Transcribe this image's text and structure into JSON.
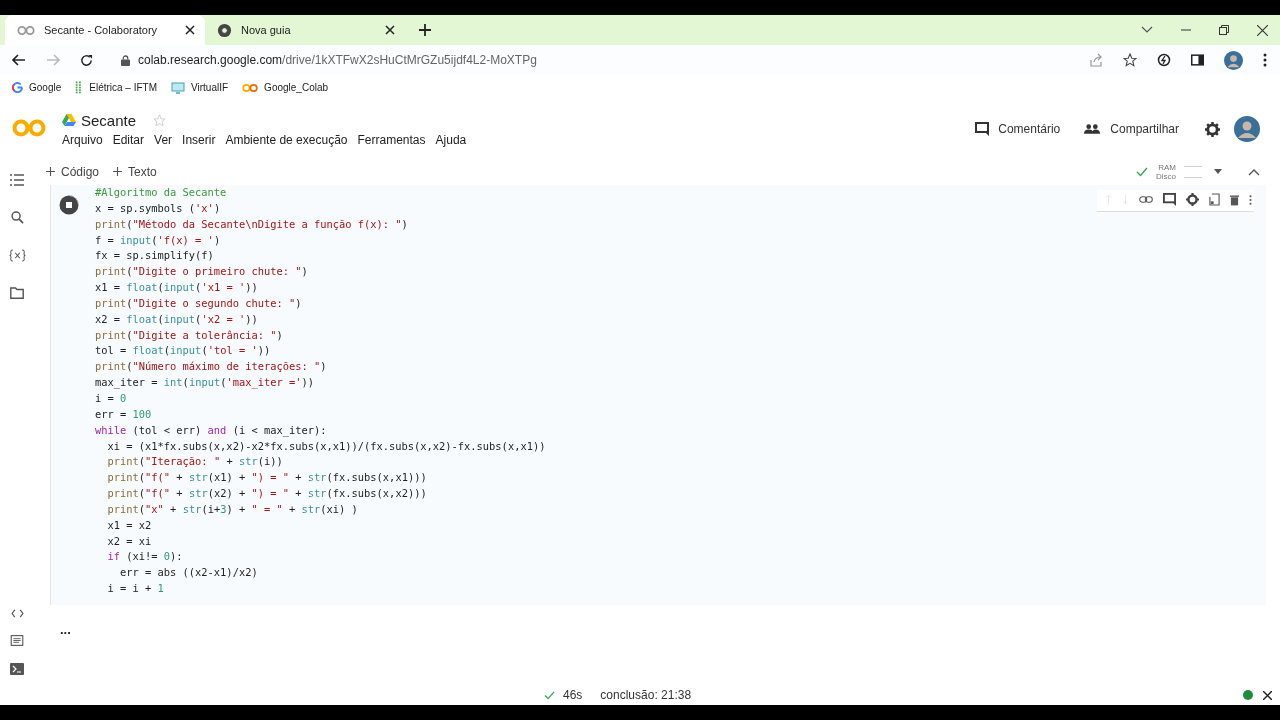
{
  "browser": {
    "tabs": [
      {
        "title": "Secante - Colaboratory",
        "selected": true,
        "kind": "colab"
      },
      {
        "title": "Nova guia",
        "selected": false,
        "kind": "chrome"
      }
    ],
    "forward_disabled": true,
    "address": {
      "host": "colab.research.google.com",
      "path": "/drive/1kXTFwX2sHuCtMrGZu5ijdf4L2-MoXTPg"
    },
    "bookmarks": [
      {
        "label": "Google",
        "kind": "google"
      },
      {
        "label": "Elétrica – IFTM",
        "kind": "grid"
      },
      {
        "label": "VirtualIF",
        "kind": "screen"
      },
      {
        "label": "Google_Colab",
        "kind": "colab"
      }
    ]
  },
  "notebook": {
    "title": "Secante",
    "starred": false,
    "menu": [
      "Arquivo",
      "Editar",
      "Ver",
      "Inserir",
      "Ambiente de execução",
      "Ferramentas",
      "Ajuda"
    ],
    "comment_button": "Comentário",
    "share_button": "Compartilhar",
    "add_buttons": [
      "Código",
      "Texto"
    ],
    "runtime": {
      "connected": true,
      "ram_label": "RAM",
      "disk_label": "Disco"
    },
    "cell": {
      "running": true,
      "lines": [
        [
          {
            "kind": "comment",
            "text": "#Algoritmo da Secante"
          }
        ],
        [
          {
            "kind": "plain",
            "text": "x = sp.symbols ("
          },
          {
            "kind": "string",
            "text": "'x'"
          },
          {
            "kind": "plain",
            "text": ")"
          }
        ],
        [
          {
            "kind": "function",
            "text": "print"
          },
          {
            "kind": "plain",
            "text": "("
          },
          {
            "kind": "string",
            "text": "\"Método da Secante\\nDigite a função f(x): \""
          },
          {
            "kind": "plain",
            "text": ")"
          }
        ],
        [
          {
            "kind": "plain",
            "text": "f = "
          },
          {
            "kind": "builtin",
            "text": "input"
          },
          {
            "kind": "plain",
            "text": "("
          },
          {
            "kind": "string",
            "text": "'f(x) = '"
          },
          {
            "kind": "plain",
            "text": ")"
          }
        ],
        [
          {
            "kind": "plain",
            "text": "fx = sp.simplify(f)"
          }
        ],
        [
          {
            "kind": "function",
            "text": "print"
          },
          {
            "kind": "plain",
            "text": "("
          },
          {
            "kind": "string",
            "text": "\"Digite o primeiro chute: \""
          },
          {
            "kind": "plain",
            "text": ")"
          }
        ],
        [
          {
            "kind": "plain",
            "text": "x1 = "
          },
          {
            "kind": "builtin",
            "text": "float"
          },
          {
            "kind": "plain",
            "text": "("
          },
          {
            "kind": "builtin",
            "text": "input"
          },
          {
            "kind": "plain",
            "text": "("
          },
          {
            "kind": "string",
            "text": "'x1 = '"
          },
          {
            "kind": "plain",
            "text": "))"
          }
        ],
        [
          {
            "kind": "function",
            "text": "print"
          },
          {
            "kind": "plain",
            "text": "("
          },
          {
            "kind": "string",
            "text": "\"Digite o segundo chute: \""
          },
          {
            "kind": "plain",
            "text": ")"
          }
        ],
        [
          {
            "kind": "plain",
            "text": "x2 = "
          },
          {
            "kind": "builtin",
            "text": "float"
          },
          {
            "kind": "plain",
            "text": "("
          },
          {
            "kind": "builtin",
            "text": "input"
          },
          {
            "kind": "plain",
            "text": "("
          },
          {
            "kind": "string",
            "text": "'x2 = '"
          },
          {
            "kind": "plain",
            "text": "))"
          }
        ],
        [
          {
            "kind": "function",
            "text": "print"
          },
          {
            "kind": "plain",
            "text": "("
          },
          {
            "kind": "string",
            "text": "\"Digite a tolerância: \""
          },
          {
            "kind": "plain",
            "text": ")"
          }
        ],
        [
          {
            "kind": "plain",
            "text": "tol = "
          },
          {
            "kind": "builtin",
            "text": "float"
          },
          {
            "kind": "plain",
            "text": "("
          },
          {
            "kind": "builtin",
            "text": "input"
          },
          {
            "kind": "plain",
            "text": "("
          },
          {
            "kind": "string",
            "text": "'tol = '"
          },
          {
            "kind": "plain",
            "text": "))"
          }
        ],
        [
          {
            "kind": "function",
            "text": "print"
          },
          {
            "kind": "plain",
            "text": "("
          },
          {
            "kind": "string",
            "text": "\"Número máximo de iterações: \""
          },
          {
            "kind": "plain",
            "text": ")"
          }
        ],
        [
          {
            "kind": "plain",
            "text": "max_iter = "
          },
          {
            "kind": "builtin",
            "text": "int"
          },
          {
            "kind": "plain",
            "text": "("
          },
          {
            "kind": "builtin",
            "text": "input"
          },
          {
            "kind": "plain",
            "text": "("
          },
          {
            "kind": "string",
            "text": "'max_iter ='"
          },
          {
            "kind": "plain",
            "text": "))"
          }
        ],
        [
          {
            "kind": "plain",
            "text": "i = "
          },
          {
            "kind": "number",
            "text": "0"
          }
        ],
        [
          {
            "kind": "plain",
            "text": "err = "
          },
          {
            "kind": "number",
            "text": "100"
          }
        ],
        [
          {
            "kind": "keyword",
            "text": "while"
          },
          {
            "kind": "plain",
            "text": " (tol < err) "
          },
          {
            "kind": "keyword",
            "text": "and"
          },
          {
            "kind": "plain",
            "text": " (i < max_iter):"
          }
        ],
        [
          {
            "kind": "plain",
            "text": "  xi = (x1*fx.subs(x,x2)-x2*fx.subs(x,x1))/(fx.subs(x,x2)-fx.subs(x,x1))"
          }
        ],
        [
          {
            "kind": "function",
            "text": "  print"
          },
          {
            "kind": "plain",
            "text": "("
          },
          {
            "kind": "string",
            "text": "\"Iteração: \""
          },
          {
            "kind": "plain",
            "text": " + "
          },
          {
            "kind": "builtin",
            "text": "str"
          },
          {
            "kind": "plain",
            "text": "(i))"
          }
        ],
        [
          {
            "kind": "function",
            "text": "  print"
          },
          {
            "kind": "plain",
            "text": "("
          },
          {
            "kind": "string",
            "text": "\"f(\""
          },
          {
            "kind": "plain",
            "text": " + "
          },
          {
            "kind": "builtin",
            "text": "str"
          },
          {
            "kind": "plain",
            "text": "(x1) + "
          },
          {
            "kind": "string",
            "text": "\") = \""
          },
          {
            "kind": "plain",
            "text": " + "
          },
          {
            "kind": "builtin",
            "text": "str"
          },
          {
            "kind": "plain",
            "text": "(fx.subs(x,x1)))"
          }
        ],
        [
          {
            "kind": "function",
            "text": "  print"
          },
          {
            "kind": "plain",
            "text": "("
          },
          {
            "kind": "string",
            "text": "\"f(\""
          },
          {
            "kind": "plain",
            "text": " + "
          },
          {
            "kind": "builtin",
            "text": "str"
          },
          {
            "kind": "plain",
            "text": "(x2) + "
          },
          {
            "kind": "string",
            "text": "\") = \""
          },
          {
            "kind": "plain",
            "text": " + "
          },
          {
            "kind": "builtin",
            "text": "str"
          },
          {
            "kind": "plain",
            "text": "(fx.subs(x,x2)))"
          }
        ],
        [
          {
            "kind": "function",
            "text": "  print"
          },
          {
            "kind": "plain",
            "text": "("
          },
          {
            "kind": "string",
            "text": "\"x\""
          },
          {
            "kind": "plain",
            "text": " + "
          },
          {
            "kind": "builtin",
            "text": "str"
          },
          {
            "kind": "plain",
            "text": "(i+"
          },
          {
            "kind": "number",
            "text": "3"
          },
          {
            "kind": "plain",
            "text": ") + "
          },
          {
            "kind": "string",
            "text": "\" = \""
          },
          {
            "kind": "plain",
            "text": " + "
          },
          {
            "kind": "builtin",
            "text": "str"
          },
          {
            "kind": "plain",
            "text": "(xi) )"
          }
        ],
        [
          {
            "kind": "plain",
            "text": "  x1 = x2"
          }
        ],
        [
          {
            "kind": "plain",
            "text": "  x2 = xi"
          }
        ],
        [
          {
            "kind": "keyword",
            "text": "  if"
          },
          {
            "kind": "plain",
            "text": " (xi!= "
          },
          {
            "kind": "number",
            "text": "0"
          },
          {
            "kind": "plain",
            "text": "):"
          }
        ],
        [
          {
            "kind": "plain",
            "text": "    err = abs ((x2-x1)/x2)"
          }
        ],
        [
          {
            "kind": "plain",
            "text": "  i = i + "
          },
          {
            "kind": "number",
            "text": "1"
          }
        ]
      ],
      "output_marker": "..."
    }
  },
  "status_bar": {
    "ok": true,
    "elapsed": "46s",
    "completion": "conclusão: 21:38",
    "connected": true
  }
}
